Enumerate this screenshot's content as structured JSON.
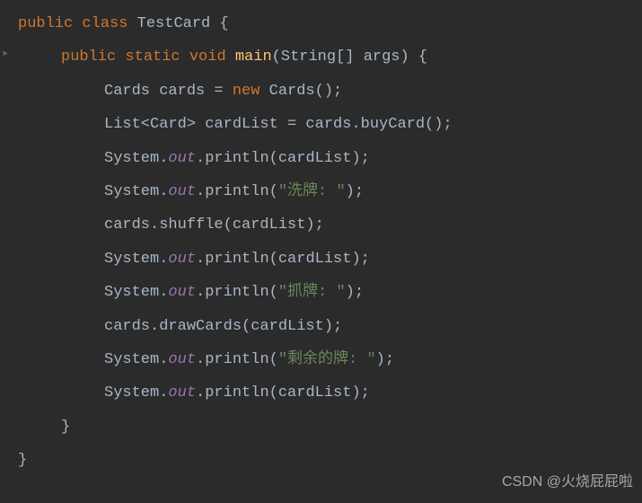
{
  "code": {
    "line1": {
      "kw1": "public ",
      "kw2": "class ",
      "name": "TestCard ",
      "brace": "{"
    },
    "line2": {
      "kw1": "public ",
      "kw2": "static ",
      "kw3": "void ",
      "method": "main",
      "params": "(String[] args) ",
      "brace": "{"
    },
    "line3": {
      "t1": "Cards cards = ",
      "kw": "new ",
      "t2": "Cards();"
    },
    "line4": {
      "t1": "List<Card> cardList = cards.buyCard();"
    },
    "line5": {
      "t1": "System.",
      "field": "out",
      "t2": ".println(cardList);"
    },
    "line6": {
      "t1": "System.",
      "field": "out",
      "t2": ".println(",
      "str": "\"洗牌: \"",
      "t3": ");"
    },
    "line7": {
      "t1": "cards.shuffle(cardList);"
    },
    "line8": {
      "t1": "System.",
      "field": "out",
      "t2": ".println(cardList);"
    },
    "line9": {
      "t1": "System.",
      "field": "out",
      "t2": ".println(",
      "str": "\"抓牌: \"",
      "t3": ");"
    },
    "line10": {
      "t1": "cards.drawCards(cardList);"
    },
    "line11": {
      "t1": "System.",
      "field": "out",
      "t2": ".println(",
      "str": "\"剩余的牌: \"",
      "t3": ");"
    },
    "line12": {
      "t1": "System.",
      "field": "out",
      "t2": ".println(cardList);"
    },
    "line13": {
      "brace": "}"
    },
    "line14": {
      "brace": "}"
    }
  },
  "watermark": "CSDN @火烧屁屁啦"
}
